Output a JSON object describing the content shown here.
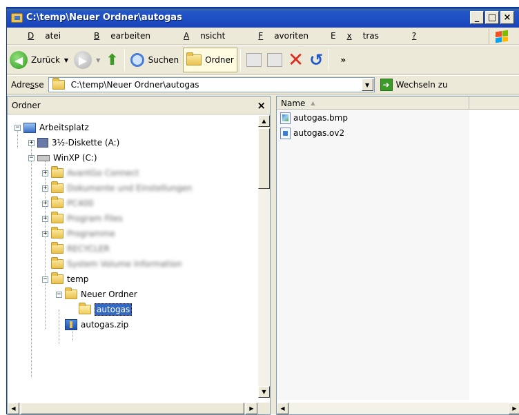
{
  "window": {
    "title": "C:\\temp\\Neuer Ordner\\autogas",
    "minimize": "_",
    "maximize": "□",
    "close": "×"
  },
  "menu": [
    {
      "pre": "",
      "u": "D",
      "post": "atei"
    },
    {
      "pre": "",
      "u": "B",
      "post": "earbeiten"
    },
    {
      "pre": "",
      "u": "A",
      "post": "nsicht"
    },
    {
      "pre": "",
      "u": "F",
      "post": "avoriten"
    },
    {
      "pre": "E",
      "u": "x",
      "post": "tras"
    },
    {
      "pre": "",
      "u": "?",
      "post": ""
    }
  ],
  "toolbar": {
    "back_label": "Zurück",
    "search_label": "Suchen",
    "folders_label": "Ordner",
    "more": "»"
  },
  "address": {
    "label_pre": "Adre",
    "label_u": "s",
    "label_post": "se",
    "value": "C:\\temp\\Neuer Ordner\\autogas",
    "go_label": "Wechseln zu"
  },
  "folders_pane": {
    "title": "Ordner",
    "close": "×"
  },
  "tree": {
    "arbeitsplatz": "Arbeitsplatz",
    "diskette": "3½-Diskette (A:)",
    "winxp": "WinXP (C:)",
    "blurred": [
      "AvantGo Connect",
      "Dokumente und Einstellungen",
      "PC400",
      "Program Files",
      "Programme",
      "RECYCLER",
      "System Volume Information"
    ],
    "temp": "temp",
    "neuer_ordner": "Neuer Ordner",
    "autogas": "autogas",
    "autogas_zip": "autogas.zip"
  },
  "files": {
    "column_name": "Name",
    "sort_arrow": "▲",
    "items": [
      "autogas.bmp",
      "autogas.ov2"
    ]
  },
  "colors": {
    "title_blue": "#1e4fc2",
    "selection": "#316ac5",
    "face": "#ece9d8"
  }
}
